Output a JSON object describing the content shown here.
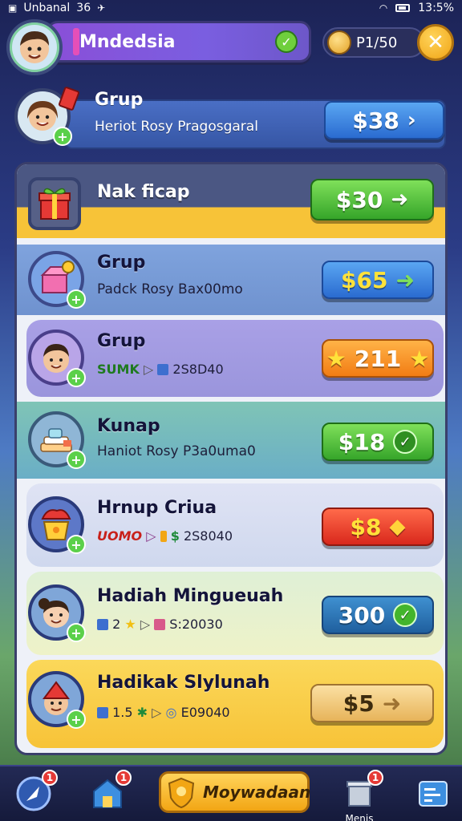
{
  "status_bar": {
    "carrier": "Unbanal",
    "signal": "36",
    "time": "13:5%"
  },
  "header": {
    "player_name": "Mndedsia",
    "coins": "P1/50"
  },
  "top_offer": {
    "title": "Grup",
    "subtitle": "Heriot Rosy Pragosgaral",
    "price": "$38"
  },
  "panel_header": {
    "title": "Nak ficap",
    "price": "$30"
  },
  "items": [
    {
      "title": "Grup",
      "subtitle": "Padck Rosy Bax00mo",
      "price": "$65"
    },
    {
      "title": "Grup",
      "sub_prefix": "SUMK",
      "sub_value": "2S8D40",
      "price": "211"
    },
    {
      "title": "Kunap",
      "subtitle": "Haniot Rosy P3a0uma0",
      "price": "$18"
    },
    {
      "title": "Hrnup Criua",
      "sub_prefix": "UOMO",
      "sub_value": "2S8040",
      "price": "$8"
    },
    {
      "title": "Hadiah Mingueuah",
      "sub_count": "2",
      "sub_value": "S:20030",
      "price": "300"
    },
    {
      "title": "Hadikak Slylunah",
      "sub_count": "1.5",
      "sub_value": "E09040",
      "price": "$5"
    }
  ],
  "nav": {
    "profile_badge": "1",
    "shop_badge": "1",
    "center_label": "Moywadaan",
    "menu_badge": "1",
    "menu_label": "Menis"
  },
  "colors": {
    "panel_yellow": "#f7c338",
    "accent_purple": "#7a5ee0",
    "button_green": "#36a52a",
    "button_blue": "#2a6bd0"
  }
}
